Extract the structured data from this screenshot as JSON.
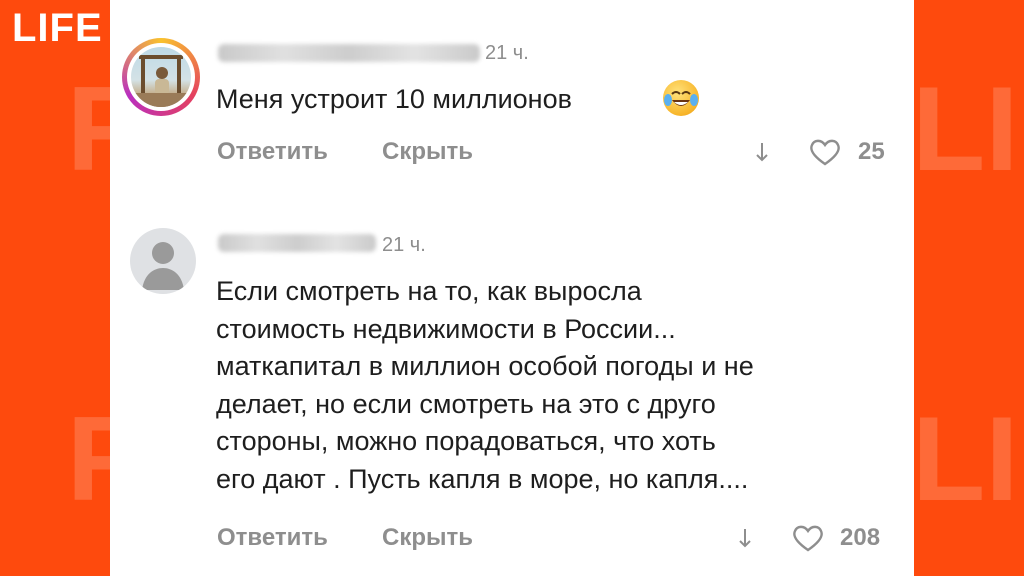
{
  "brand": {
    "logo": "LIFE",
    "watermark": "LIFE",
    "accent": "#fe4a0d"
  },
  "comments": [
    {
      "time": "21 ч.",
      "text": [
        "Меня устроит 10 миллионов"
      ],
      "emoji": "face-with-tears-of-joy",
      "reply_label": "Ответить",
      "hide_label": "Скрыть",
      "likes": "25"
    },
    {
      "time": "21 ч.",
      "text": [
        "Если смотреть на то, как выросла",
        "стоимость недвижимости в России...",
        "маткапитал в миллион особой погоды и не",
        "делает, но если смотреть на это с друго",
        "стороны, можно порадоваться, что хоть",
        "его дают . Пусть капля в море, но капля...."
      ],
      "reply_label": "Ответить",
      "hide_label": "Скрыть",
      "likes": "208"
    }
  ]
}
